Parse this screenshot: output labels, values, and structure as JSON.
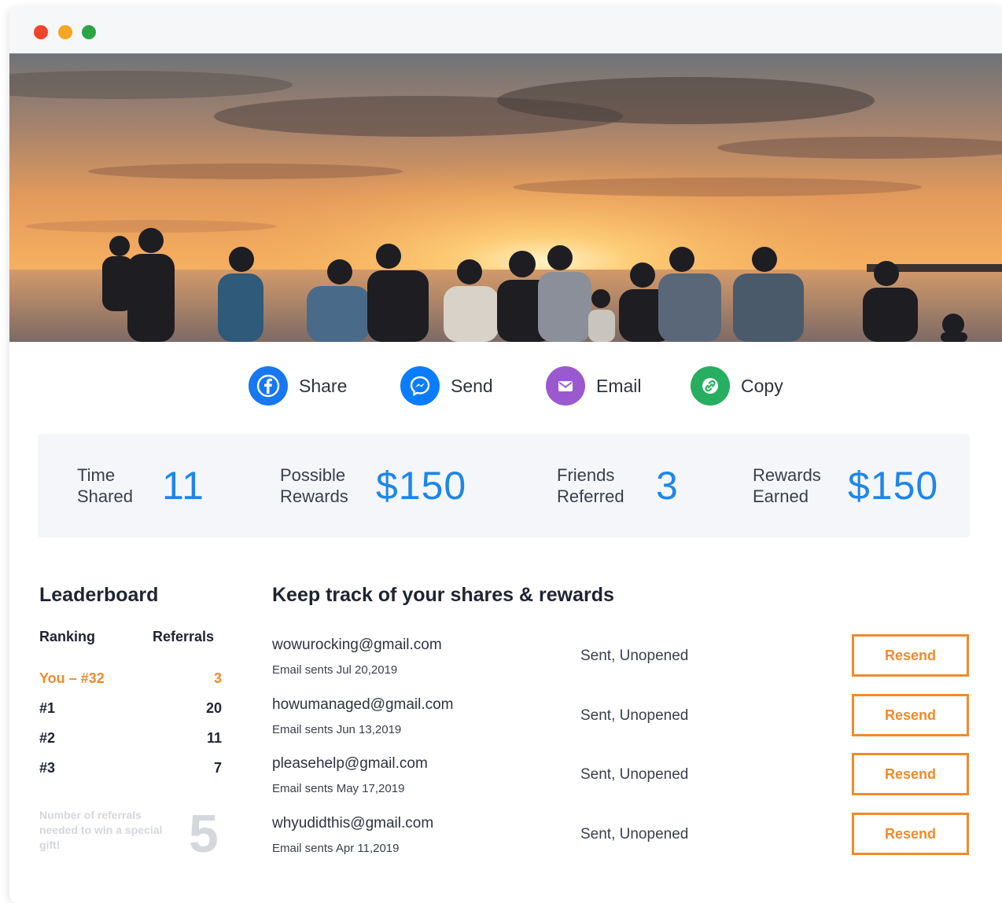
{
  "share": {
    "items": [
      {
        "label": "Share",
        "icon": "facebook-icon",
        "color": "#1877f2"
      },
      {
        "label": "Send",
        "icon": "messenger-icon",
        "color": "#0a7cff"
      },
      {
        "label": "Email",
        "icon": "email-icon",
        "color": "#9b59d0"
      },
      {
        "label": "Copy",
        "icon": "link-icon",
        "color": "#27ae60"
      }
    ]
  },
  "stats": [
    {
      "label_line1": "Time",
      "label_line2": "Shared",
      "value": "11"
    },
    {
      "label_line1": "Possible",
      "label_line2": "Rewards",
      "value": "$150"
    },
    {
      "label_line1": "Friends",
      "label_line2": "Referred",
      "value": "3"
    },
    {
      "label_line1": "Rewards",
      "label_line2": "Earned",
      "value": "$150"
    }
  ],
  "leaderboard": {
    "title": "Leaderboard",
    "col_ranking": "Ranking",
    "col_referrals": "Referrals",
    "rows": [
      {
        "rank": "You – #32",
        "referrals": "3",
        "is_you": true
      },
      {
        "rank": "#1",
        "referrals": "20"
      },
      {
        "rank": "#2",
        "referrals": "11"
      },
      {
        "rank": "#3",
        "referrals": "7"
      }
    ],
    "note": "Number of referrals needed to win a special gift!",
    "needed": "5"
  },
  "tracking": {
    "title": "Keep track of your shares & rewards",
    "button_label": "Resend",
    "rows": [
      {
        "email": "wowurocking@gmail.com",
        "date": "Email sents Jul 20,2019",
        "status": "Sent, Unopened"
      },
      {
        "email": "howumanaged@gmail.com",
        "date": "Email sents Jun 13,2019",
        "status": "Sent, Unopened"
      },
      {
        "email": "pleasehelp@gmail.com",
        "date": "Email sents May 17,2019",
        "status": "Sent, Unopened"
      },
      {
        "email": "whyudidthis@gmail.com",
        "date": "Email sents Apr 11,2019",
        "status": "Sent, Unopened"
      }
    ]
  },
  "colors": {
    "accent_blue": "#1f86e8",
    "accent_orange": "#f18a2a"
  }
}
